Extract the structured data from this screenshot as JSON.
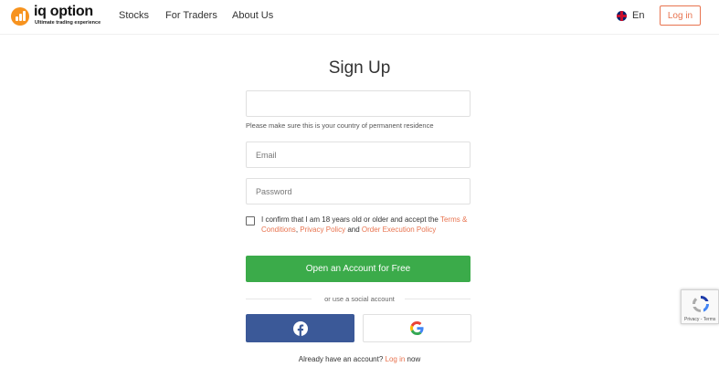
{
  "header": {
    "logo_text": "iq option",
    "logo_tagline": "Ultimate trading experience",
    "nav": [
      "Stocks",
      "For Traders",
      "About Us"
    ],
    "language": "En",
    "login_label": "Log in"
  },
  "form": {
    "title": "Sign Up",
    "country_value": "",
    "country_hint": "Please make sure this is your country of permanent residence",
    "email_placeholder": "Email",
    "password_placeholder": "Password",
    "confirm_prefix": "I confirm that I am 18 years old or older and accept the",
    "terms_link": "Terms & Conditions",
    "comma": ",",
    "privacy_link": "Privacy Policy",
    "and_text": "and",
    "execution_link": "Order Execution Policy",
    "submit_label": "Open an Account for Free",
    "social_divider": "or use a social account",
    "already_text": "Already have an account?",
    "already_link": "Log in",
    "already_suffix": "now"
  },
  "recaptcha": {
    "footer": "Privacy - Terms"
  },
  "colors": {
    "accent": "#e8734f",
    "cta": "#3bab4a",
    "facebook": "#3b5998",
    "brand": "#f7931e"
  },
  "icons": {
    "facebook": "facebook-icon",
    "google": "google-icon",
    "flag": "uk-flag-icon",
    "recaptcha": "recaptcha-icon"
  }
}
